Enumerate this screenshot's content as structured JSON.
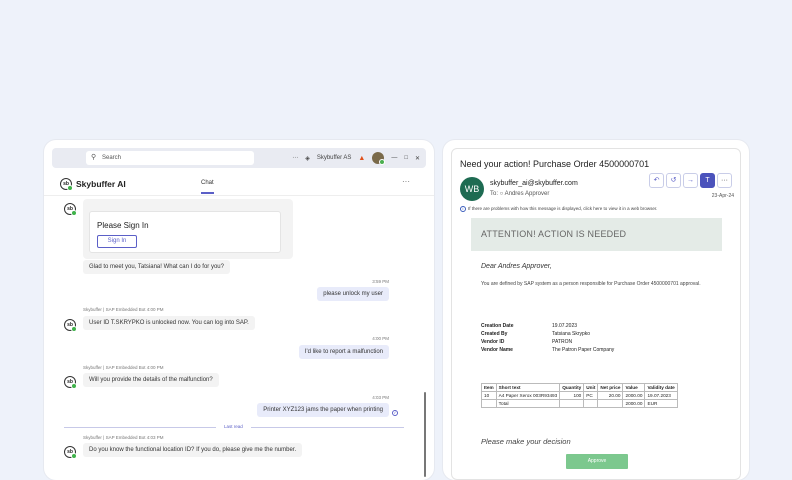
{
  "teams": {
    "search_placeholder": "Search",
    "org": "Skybuffer AS",
    "app_name": "Skybuffer AI",
    "tab": "Chat",
    "more": "···",
    "logo": "sb",
    "card": {
      "title": "Please Sign In",
      "button": "Sign In"
    },
    "messages": [
      {
        "text": "Glad to meet you, Tatsiana! What can I do for you?"
      },
      {
        "time": "3:59 PM",
        "text": "please unlock my user"
      },
      {
        "meta": "Skybuffer | SAP Embedded Bot  4:00 PM",
        "text": "User ID T.SKRYPKO is unlocked now. You can log into SAP."
      },
      {
        "time": "4:00 PM",
        "text": "I'd like to report a malfunction"
      },
      {
        "meta": "Skybuffer | SAP Embedded Bot  4:00 PM",
        "text": "Will you provide the details of the malfunction?"
      },
      {
        "time": "4:03 PM",
        "text": "Printer XYZ123 jams the paper when printing"
      },
      {
        "meta": "Skybuffer | SAP Embedded Bot  4:03 PM",
        "text": "Do you know the functional location ID? If you do, please give me the number."
      }
    ],
    "last_read": "Last read"
  },
  "mail": {
    "subject": "Need your action! Purchase Order 4500000701",
    "avatar": "WB",
    "from": "skybuffer_ai@skybuffer.com",
    "to": "To:  ○ Andres Approver",
    "date": "23-Apr-24",
    "info": "If there are problems with how this message is displayed, click here to view it in a web browser.",
    "banner": "ATTENTION! ACTION IS NEEDED",
    "greeting": "Dear Andres Approver,",
    "paragraph": "You are defined by SAP system as a person responsible for Purchase Order 4500000701 approval.",
    "details": [
      {
        "label": "Creation Date",
        "value": "19.07.2023"
      },
      {
        "label": "Created By",
        "value": "Tatsiana Skrypko"
      },
      {
        "label": "Vendor ID",
        "value": "PATRON"
      },
      {
        "label": "Vendor Name",
        "value": "The Patron Paper Company"
      }
    ],
    "table": {
      "headers": [
        "Item",
        "Short text",
        "Quantity",
        "Unit",
        "Net price",
        "Value",
        "Validity date"
      ],
      "rows": [
        [
          "10",
          "A4 Paper Xerox 003R93493",
          "100",
          "PC",
          "20.00",
          "2000.00",
          "19.07.2023"
        ],
        [
          "",
          "Total",
          "",
          "",
          "",
          "2000.00",
          "EUR"
        ]
      ]
    },
    "decision": "Please make your decision",
    "approve": "Approve"
  }
}
